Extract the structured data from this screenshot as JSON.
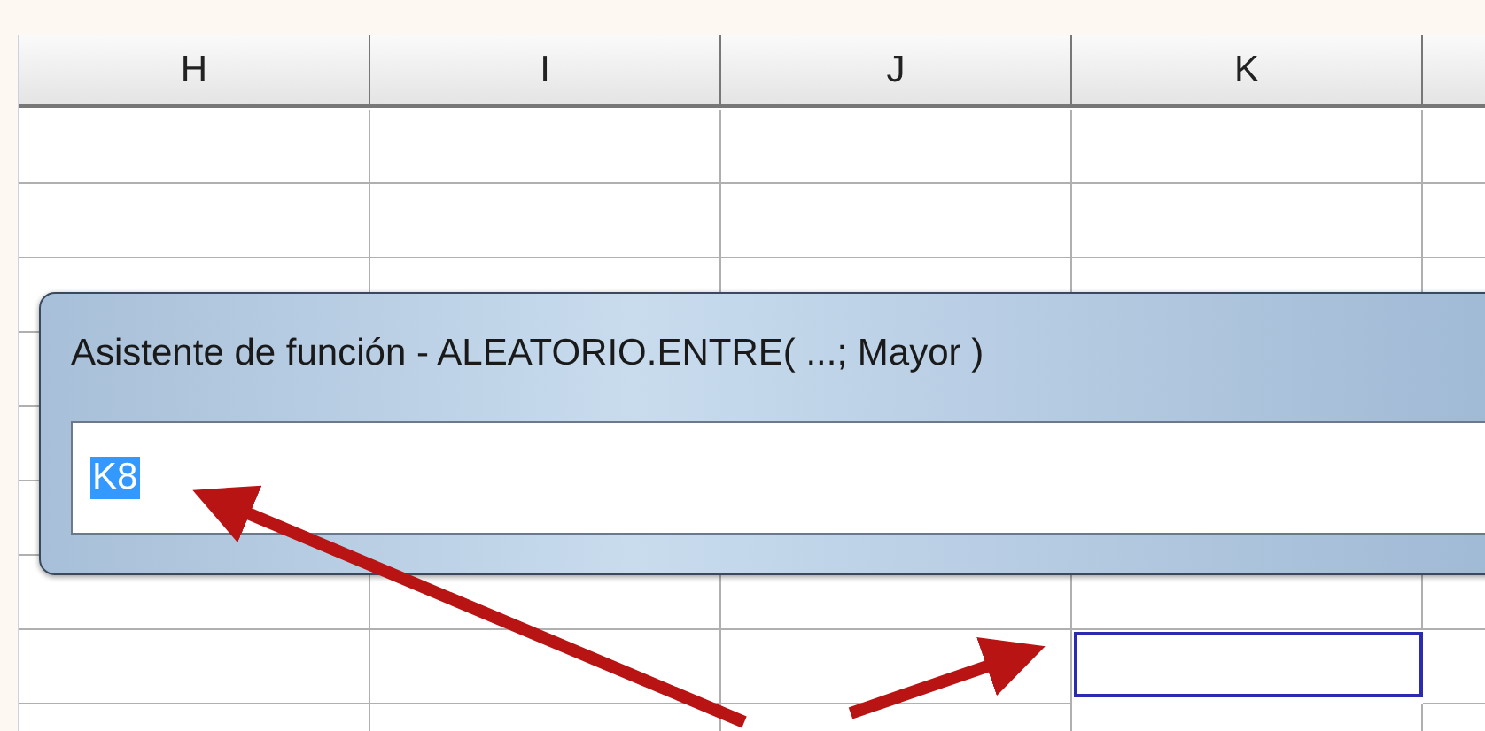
{
  "sheet": {
    "columns": [
      {
        "label": "H"
      },
      {
        "label": "I"
      },
      {
        "label": "J"
      },
      {
        "label": "K"
      }
    ],
    "rows": [
      {
        "cells": [
          {
            "selected": false
          },
          {
            "selected": false
          },
          {
            "selected": false
          },
          {
            "selected": false
          },
          {
            "selected": false
          }
        ]
      },
      {
        "cells": [
          {
            "selected": false
          },
          {
            "selected": false
          },
          {
            "selected": false
          },
          {
            "selected": false
          },
          {
            "selected": false
          }
        ]
      },
      {
        "cells": [
          {
            "selected": false
          },
          {
            "selected": false
          },
          {
            "selected": false
          },
          {
            "selected": false
          },
          {
            "selected": false
          }
        ]
      },
      {
        "cells": [
          {
            "selected": false
          },
          {
            "selected": false
          },
          {
            "selected": false
          },
          {
            "selected": true
          },
          {
            "selected": false
          }
        ]
      },
      {
        "cells": [
          {
            "selected": false
          },
          {
            "selected": false
          },
          {
            "selected": false
          },
          {
            "selected": false
          }
        ]
      }
    ]
  },
  "dialog": {
    "title": "Asistente de función - ALEATORIO.ENTRE( ...; Mayor )",
    "input": {
      "value": "K8",
      "value_selected": true
    }
  }
}
